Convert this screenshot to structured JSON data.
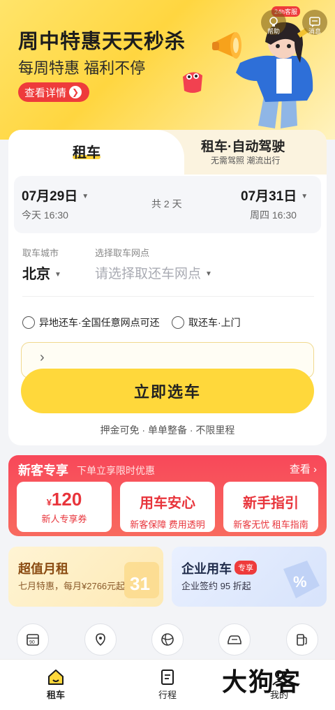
{
  "banner": {
    "title": "周中特惠天天秒杀",
    "subtitle": "每周特惠 福利不停",
    "detail_button": "查看详情",
    "help_badge": "24h客服",
    "help_label": "帮助",
    "message_label": "消息"
  },
  "tabs": {
    "rent": "租车",
    "auto": "租车·自动驾驶",
    "auto_sub": "无需驾照 潮流出行"
  },
  "dates": {
    "start_date": "07月29日",
    "start_time": "今天 16:30",
    "duration": "共 2 天",
    "end_date": "07月31日",
    "end_time": "周四 16:30"
  },
  "pickup": {
    "city_label": "取车城市",
    "city_value": "北京",
    "station_label": "选择取车网点",
    "station_placeholder": "请选择取还车网点"
  },
  "options": {
    "diff_return": "异地还车·全国任意网点可还",
    "door_service": "取还车·上门"
  },
  "actions": {
    "select_car": "立即选车",
    "perks": "押金可免 · 单单整备 · 不限里程"
  },
  "new_customer": {
    "title": "新客专享",
    "subtitle": "下单立享限时优惠",
    "more": "查看",
    "coupons": [
      {
        "title_prefix": "¥",
        "title": "120",
        "desc": "新人专享券"
      },
      {
        "title": "用车安心",
        "desc": "新客保障 费用透明"
      },
      {
        "title": "新手指引",
        "desc": "新客无忧 租车指南"
      }
    ]
  },
  "promos": {
    "monthly_title": "超值月租",
    "monthly_desc": "七月特惠，每月¥2766元起",
    "enterprise_title": "企业用车",
    "enterprise_tag": "专享",
    "enterprise_desc": "企业签约 95 折起"
  },
  "bottom_nav": {
    "rent": "租车",
    "trips": "行程",
    "mine": "我的"
  },
  "watermark": "大狗客",
  "colors": {
    "accent_yellow": "#ffd83b",
    "accent_red": "#ee3b3b"
  }
}
